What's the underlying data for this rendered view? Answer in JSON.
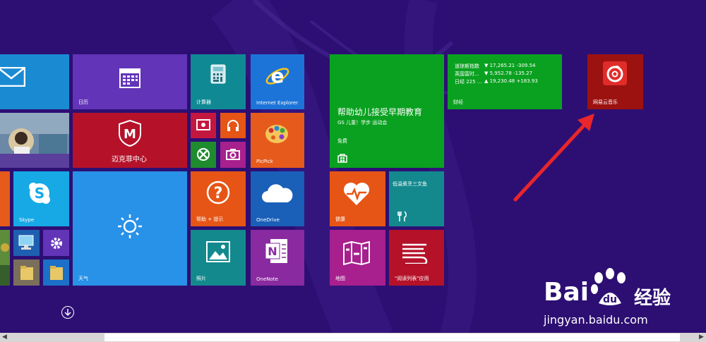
{
  "tiles": {
    "mail": {
      "label": ""
    },
    "calendar": {
      "label": "日历"
    },
    "calculator": {
      "label": "计算器"
    },
    "ie": {
      "label": "Internet Explorer"
    },
    "people": {
      "label": ""
    },
    "mcafee": {
      "label": "迈克菲中心"
    },
    "skype": {
      "label": "Skype"
    },
    "weather": {
      "label": "天气"
    },
    "help": {
      "label": "帮助 + 提示"
    },
    "onedrive": {
      "label": "OneDrive"
    },
    "picpick": {
      "label": "PicPick"
    },
    "photos": {
      "label": "照片"
    },
    "onenote": {
      "label": "OneNote"
    },
    "store_ad": {
      "title": "帮助幼儿接受早期教育",
      "subtitle": "GS 儿童！学步 运动会",
      "price": "免费"
    },
    "finance": {
      "label": "财经",
      "rows": [
        {
          "name": "道琼斯指数",
          "value": "▼ 17,265.21 -309.54"
        },
        {
          "name": "英国富时...",
          "value": "▼ 5,952.78 -135.27"
        },
        {
          "name": "日经 225 ...",
          "value": "▲ 19,230.48 +183.93"
        }
      ]
    },
    "netease": {
      "label": "网易云音乐"
    },
    "health": {
      "label": "健康"
    },
    "food": {
      "label": "低温煮烹三文鱼"
    },
    "maps": {
      "label": "地图"
    },
    "reading_list": {
      "label": "\"阅读列表\"应用"
    }
  },
  "watermark": {
    "brand": "Bai",
    "brand2": "经验",
    "url": "jingyan.baidu.com"
  },
  "colors": {
    "background": "#2d0f73",
    "arrow": "#e8262b"
  }
}
